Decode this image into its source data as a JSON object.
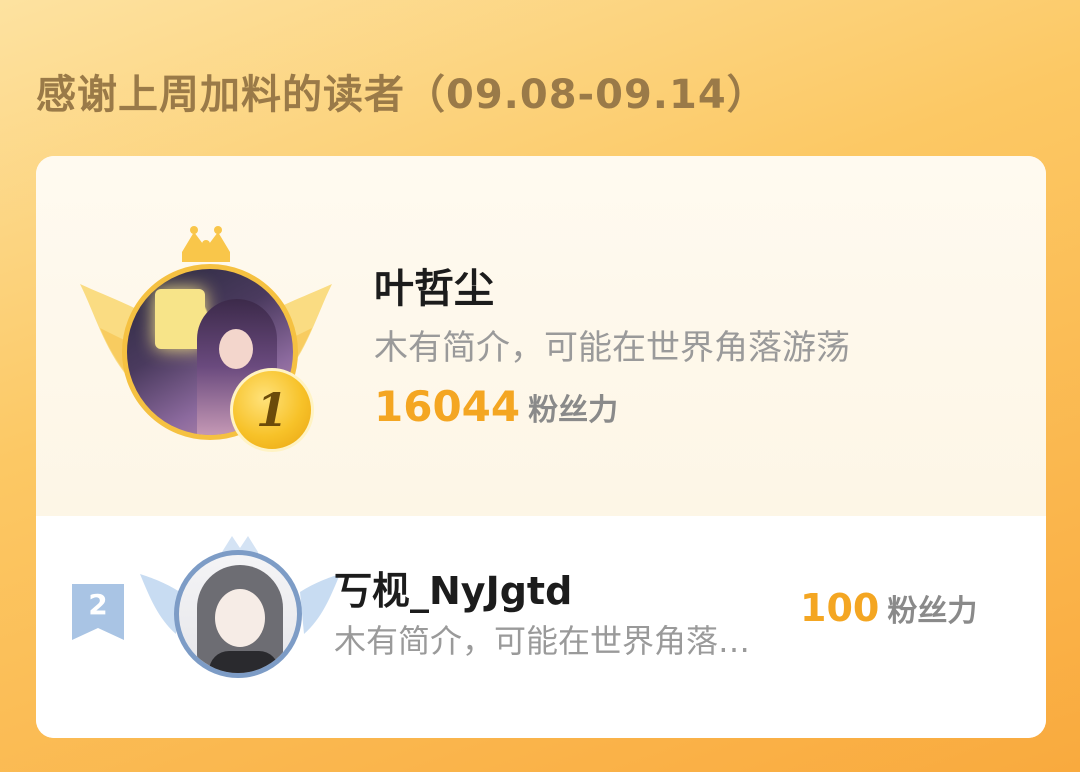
{
  "header": {
    "title": "感谢上周加料的读者（09.08-09.14）"
  },
  "readers": [
    {
      "rank": "1",
      "name": "叶哲尘",
      "bio": "木有简介，可能在世界角落游荡",
      "fans_value": "16044",
      "fans_unit": "粉丝力"
    },
    {
      "rank": "2",
      "name": "丂枧_NyJgtd",
      "bio": "木有简介，可能在世界角落游荡",
      "fans_value": "100",
      "fans_unit": "粉丝力"
    }
  ],
  "colors": {
    "accent": "#f4a622",
    "gold": "#f5c141",
    "silver": "#7d9cc6",
    "title": "#9a7a48"
  }
}
